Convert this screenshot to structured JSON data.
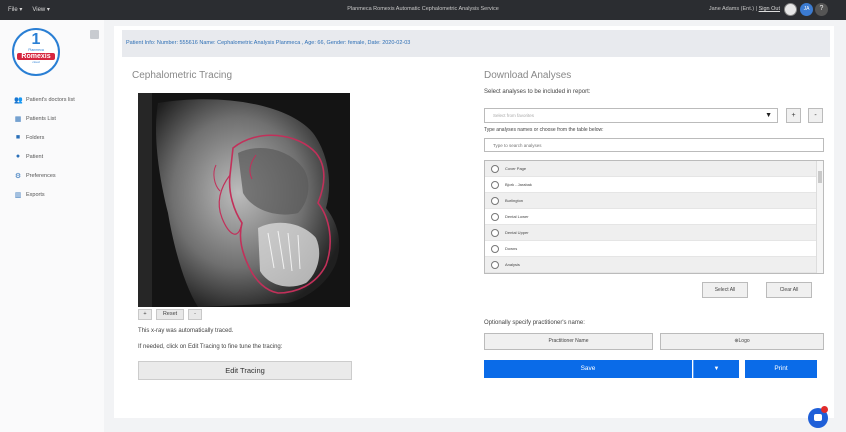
{
  "topbar": {
    "menu_file": "File ▾",
    "menu_view": "View ▾",
    "title": "Planmeca Romexis Automatic Cephalometric Analysis Service",
    "user_text": "Jane Adams (Ent.)",
    "user_link": "Sign Out",
    "avatar_initials": "JA"
  },
  "logo": {
    "big_glyph": "1",
    "tagline_top": "Planmeca",
    "name": "Romexis",
    "tagline_bottom": "cloud"
  },
  "sidebar": {
    "items": [
      {
        "label": "Patient's doctors list",
        "icon": "users-icon",
        "glyph": "👥"
      },
      {
        "label": "Patients List",
        "icon": "table-icon",
        "glyph": "▦"
      },
      {
        "label": "Folders",
        "icon": "folder-icon",
        "glyph": "■"
      },
      {
        "label": "Patient",
        "icon": "user-icon",
        "glyph": "●"
      },
      {
        "label": "Preferences",
        "icon": "gear-icon",
        "glyph": "⚙"
      },
      {
        "label": "Exports",
        "icon": "chart-icon",
        "glyph": "▥"
      }
    ]
  },
  "banner": {
    "text": "Patient Info: Number: 555616 Name: Cephalometric Analysis Planmeca , Age: 66, Gender: female, Date: 2020-02-03"
  },
  "tracing": {
    "title": "Cephalometric Tracing",
    "plus_label": "+",
    "reset_label": "Reset",
    "minus_label": "-",
    "auto_text": "This x-ray was automatically traced.",
    "hint_text": "If needed, click on Edit Tracing to fine tune the tracing:",
    "edit_button": "Edit Tracing"
  },
  "download": {
    "title": "Download Analyses",
    "select_label": "Select analyses to be included in report:",
    "favorites_placeholder": "Select from favorites",
    "add_label": "+",
    "remove_label": "-",
    "type_label": "Type analyses names or choose from the table below:",
    "search_placeholder": "Type to search analyses",
    "list": [
      "Cover Page",
      "Bjork - Jarabak",
      "Burlington",
      "Dental Lower",
      "Dental Upper",
      "Downs",
      "Analysis"
    ],
    "select_all": "Select All",
    "clear_all": "Clear All",
    "practitioner_label": "Optionally specify practitioner's name:",
    "practitioner_button": "Practitioner Name",
    "logo_button": "Logo",
    "save_button": "Save",
    "save_dropdown": "▼",
    "print_button": "Print"
  },
  "colors": {
    "accent": "#0a6be8",
    "topbar": "#2b2d31",
    "brand_red": "#d6263f",
    "link": "#2e6fb5"
  }
}
